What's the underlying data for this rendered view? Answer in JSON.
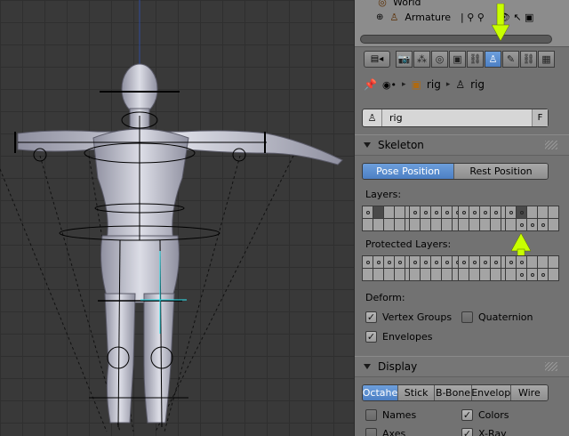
{
  "outliner": {
    "row0": "World",
    "row1": "Armature"
  },
  "breadcrumb": {
    "object": "rig",
    "data": "rig"
  },
  "name_field": {
    "value": "rig",
    "fake_user": "F"
  },
  "skeleton": {
    "title": "Skeleton",
    "pose_position": "Pose Position",
    "rest_position": "Rest Position",
    "active_mode": "pose",
    "layers_label": "Layers:",
    "protected_layers_label": "Protected Layers:",
    "deform_label": "Deform:",
    "vertex_groups": "Vertex Groups",
    "vertex_groups_checked": true,
    "quaternion": "Quaternion",
    "quaternion_checked": false,
    "envelopes": "Envelopes",
    "envelopes_checked": true
  },
  "display": {
    "title": "Display",
    "modes": [
      "Octahe",
      "Stick",
      "B-Bone",
      "Envelop",
      "Wire"
    ],
    "active_mode": "Octahe",
    "names": "Names",
    "names_checked": false,
    "colors": "Colors",
    "colors_checked": true,
    "axes": "Axes",
    "axes_checked": false,
    "xray": "X-Ray",
    "xray_checked": true
  },
  "colors": {
    "accent_blue": "#5586cf",
    "annotation_arrow": "#c8ff00",
    "panel_bg": "#727272",
    "viewport_bg": "#393939"
  },
  "icons": {
    "pin": "pin-icon",
    "armature_data": "armature-icon",
    "object": "object-cube-icon"
  }
}
